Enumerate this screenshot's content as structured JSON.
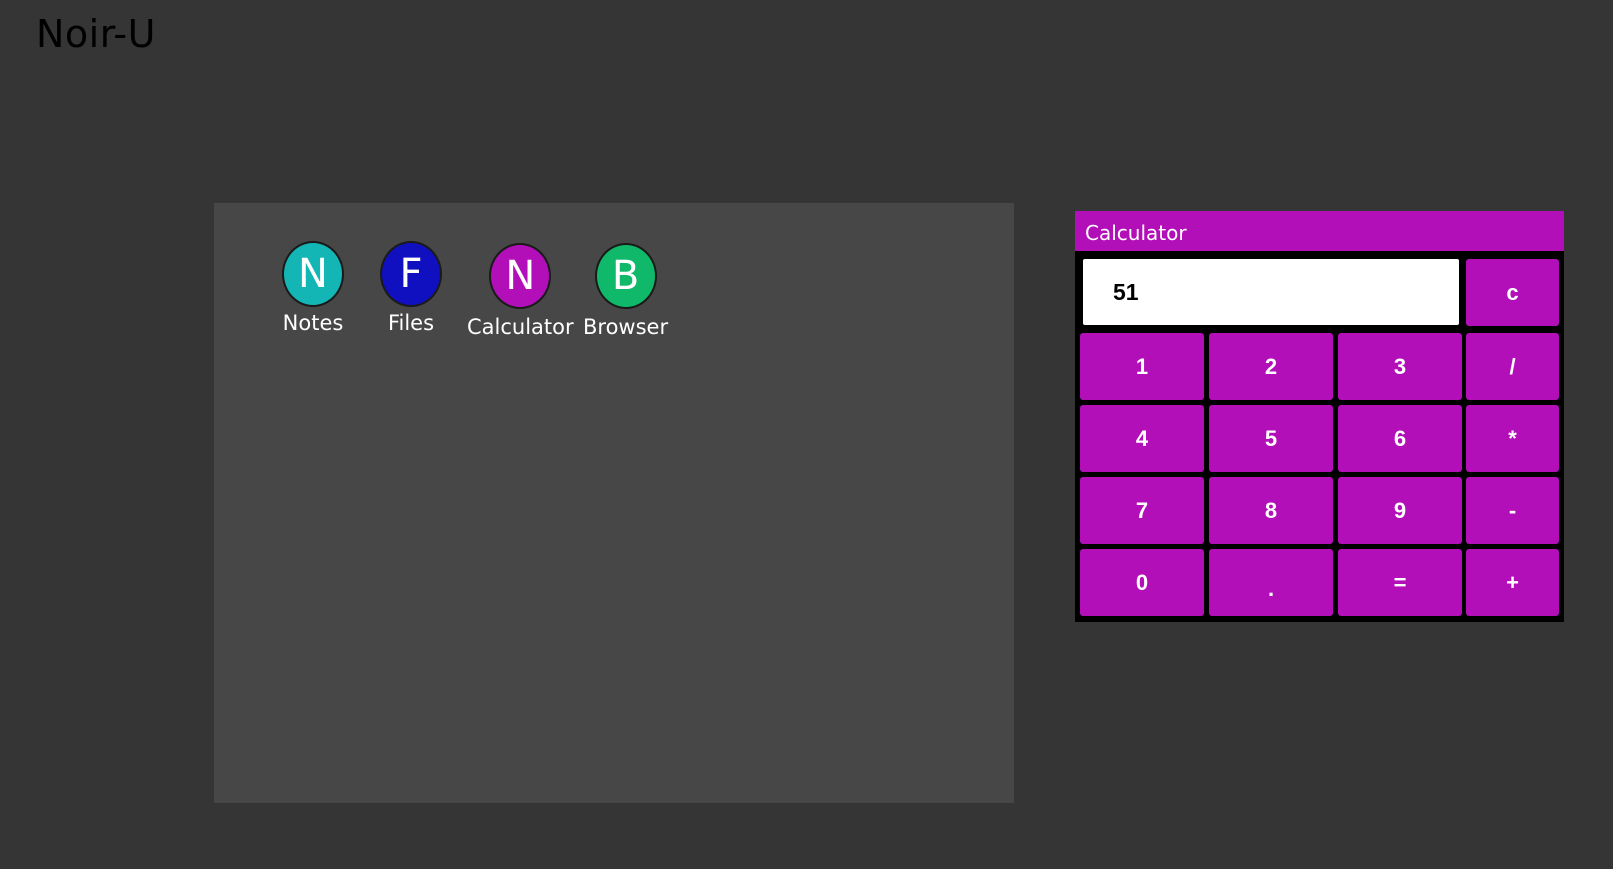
{
  "header": {
    "title": "Noir-U"
  },
  "desktop": {
    "apps": [
      {
        "letter": "N",
        "label": "Notes",
        "color": "#13b5b5"
      },
      {
        "letter": "F",
        "label": "Files",
        "color": "#1010c0"
      },
      {
        "letter": "N",
        "label": "Calculator",
        "color": "#b20fb9"
      },
      {
        "letter": "B",
        "label": "Browser",
        "color": "#10b96a"
      }
    ]
  },
  "calculator": {
    "title": "Calculator",
    "display": "51",
    "clear_label": "c",
    "keys": {
      "k1": "1",
      "k2": "2",
      "k3": "3",
      "divide": "/",
      "k4": "4",
      "k5": "5",
      "k6": "6",
      "multiply": "*",
      "k7": "7",
      "k8": "8",
      "k9": "9",
      "minus": "-",
      "k0": "0",
      "dot": ".",
      "equals": "=",
      "plus": "+"
    },
    "accent_color": "#b20fb9"
  }
}
